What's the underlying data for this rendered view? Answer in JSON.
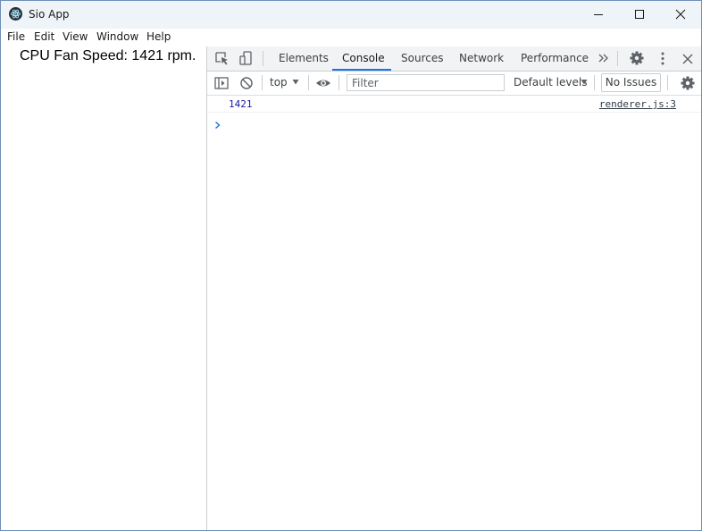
{
  "window": {
    "title": "Sio App"
  },
  "menu": {
    "items": [
      "File",
      "Edit",
      "View",
      "Window",
      "Help"
    ]
  },
  "page": {
    "fan_speed_text": "CPU Fan Speed: 1421 rpm."
  },
  "devtools": {
    "tabs": [
      "Elements",
      "Console",
      "Sources",
      "Network",
      "Performance"
    ],
    "active_tab": "Console",
    "console": {
      "context": "top",
      "filter_placeholder": "Filter",
      "filter_value": "",
      "levels_label": "Default levels",
      "issues_label": "No Issues",
      "messages": [
        {
          "value": "1421",
          "source": "renderer.js:3"
        }
      ]
    },
    "colors": {
      "active_tab_underline": "#1a73e8",
      "number_value": "#1a1aa6",
      "prompt": "#1a73e8"
    }
  },
  "icons": [
    "app-icon",
    "minimize-icon",
    "maximize-icon",
    "close-icon",
    "inspect-element-icon",
    "device-toolbar-icon",
    "more-tabs-icon",
    "settings-icon",
    "kebab-menu-icon",
    "devtools-close-icon",
    "sidebar-toggle-icon",
    "clear-console-icon",
    "dropdown-arrow-icon",
    "eye-icon",
    "console-settings-icon",
    "prompt-chevron-icon"
  ]
}
